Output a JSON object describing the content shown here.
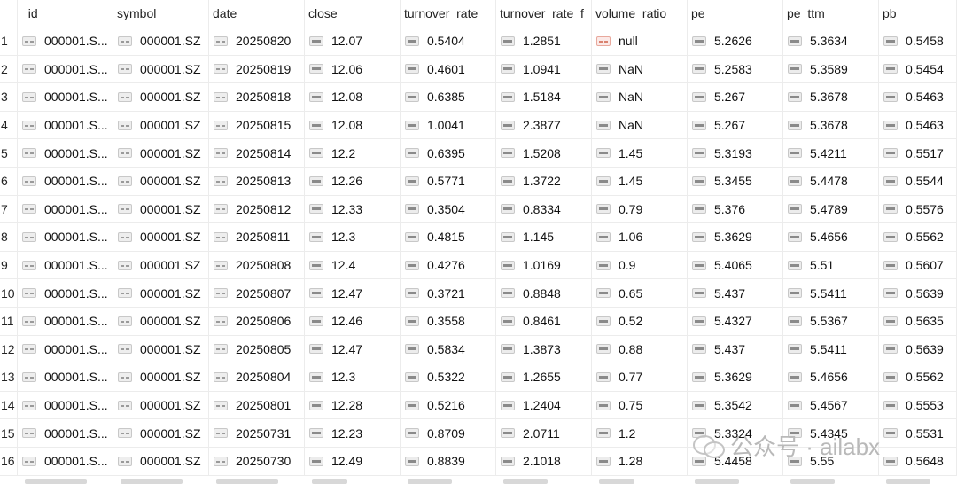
{
  "columns": [
    "_id",
    "symbol",
    "date",
    "close",
    "turnover_rate",
    "turnover_rate_f",
    "volume_ratio",
    "pe",
    "pe_ttm",
    "pb"
  ],
  "rows": [
    {
      "n": "1",
      "id": "000001.S...",
      "symbol": "000001.SZ",
      "date": "20250820",
      "close": "12.07",
      "tr": "0.5404",
      "trf": "1.2851",
      "vr": "null",
      "pe": "5.2626",
      "pettm": "5.3634",
      "pb": "0.5458"
    },
    {
      "n": "2",
      "id": "000001.S...",
      "symbol": "000001.SZ",
      "date": "20250819",
      "close": "12.06",
      "tr": "0.4601",
      "trf": "1.0941",
      "vr": "NaN",
      "pe": "5.2583",
      "pettm": "5.3589",
      "pb": "0.5454"
    },
    {
      "n": "3",
      "id": "000001.S...",
      "symbol": "000001.SZ",
      "date": "20250818",
      "close": "12.08",
      "tr": "0.6385",
      "trf": "1.5184",
      "vr": "NaN",
      "pe": "5.267",
      "pettm": "5.3678",
      "pb": "0.5463"
    },
    {
      "n": "4",
      "id": "000001.S...",
      "symbol": "000001.SZ",
      "date": "20250815",
      "close": "12.08",
      "tr": "1.0041",
      "trf": "2.3877",
      "vr": "NaN",
      "pe": "5.267",
      "pettm": "5.3678",
      "pb": "0.5463"
    },
    {
      "n": "5",
      "id": "000001.S...",
      "symbol": "000001.SZ",
      "date": "20250814",
      "close": "12.2",
      "tr": "0.6395",
      "trf": "1.5208",
      "vr": "1.45",
      "pe": "5.3193",
      "pettm": "5.4211",
      "pb": "0.5517"
    },
    {
      "n": "6",
      "id": "000001.S...",
      "symbol": "000001.SZ",
      "date": "20250813",
      "close": "12.26",
      "tr": "0.5771",
      "trf": "1.3722",
      "vr": "1.45",
      "pe": "5.3455",
      "pettm": "5.4478",
      "pb": "0.5544"
    },
    {
      "n": "7",
      "id": "000001.S...",
      "symbol": "000001.SZ",
      "date": "20250812",
      "close": "12.33",
      "tr": "0.3504",
      "trf": "0.8334",
      "vr": "0.79",
      "pe": "5.376",
      "pettm": "5.4789",
      "pb": "0.5576"
    },
    {
      "n": "8",
      "id": "000001.S...",
      "symbol": "000001.SZ",
      "date": "20250811",
      "close": "12.3",
      "tr": "0.4815",
      "trf": "1.145",
      "vr": "1.06",
      "pe": "5.3629",
      "pettm": "5.4656",
      "pb": "0.5562"
    },
    {
      "n": "9",
      "id": "000001.S...",
      "symbol": "000001.SZ",
      "date": "20250808",
      "close": "12.4",
      "tr": "0.4276",
      "trf": "1.0169",
      "vr": "0.9",
      "pe": "5.4065",
      "pettm": "5.51",
      "pb": "0.5607"
    },
    {
      "n": "10",
      "id": "000001.S...",
      "symbol": "000001.SZ",
      "date": "20250807",
      "close": "12.47",
      "tr": "0.3721",
      "trf": "0.8848",
      "vr": "0.65",
      "pe": "5.437",
      "pettm": "5.5411",
      "pb": "0.5639"
    },
    {
      "n": "11",
      "id": "000001.S...",
      "symbol": "000001.SZ",
      "date": "20250806",
      "close": "12.46",
      "tr": "0.3558",
      "trf": "0.8461",
      "vr": "0.52",
      "pe": "5.4327",
      "pettm": "5.5367",
      "pb": "0.5635"
    },
    {
      "n": "12",
      "id": "000001.S...",
      "symbol": "000001.SZ",
      "date": "20250805",
      "close": "12.47",
      "tr": "0.5834",
      "trf": "1.3873",
      "vr": "0.88",
      "pe": "5.437",
      "pettm": "5.5411",
      "pb": "0.5639"
    },
    {
      "n": "13",
      "id": "000001.S...",
      "symbol": "000001.SZ",
      "date": "20250804",
      "close": "12.3",
      "tr": "0.5322",
      "trf": "1.2655",
      "vr": "0.77",
      "pe": "5.3629",
      "pettm": "5.4656",
      "pb": "0.5562"
    },
    {
      "n": "14",
      "id": "000001.S...",
      "symbol": "000001.SZ",
      "date": "20250801",
      "close": "12.28",
      "tr": "0.5216",
      "trf": "1.2404",
      "vr": "0.75",
      "pe": "5.3542",
      "pettm": "5.4567",
      "pb": "0.5553"
    },
    {
      "n": "15",
      "id": "000001.S...",
      "symbol": "000001.SZ",
      "date": "20250731",
      "close": "12.23",
      "tr": "0.8709",
      "trf": "2.0711",
      "vr": "1.2",
      "pe": "5.3324",
      "pettm": "5.4345",
      "pb": "0.5531"
    },
    {
      "n": "16",
      "id": "000001.S...",
      "symbol": "000001.SZ",
      "date": "20250730",
      "close": "12.49",
      "tr": "0.8839",
      "trf": "2.1018",
      "vr": "1.28",
      "pe": "5.4458",
      "pettm": "5.55",
      "pb": "0.5648"
    }
  ],
  "watermark": "公众号 · ailabx",
  "colors": {
    "grid_line": "#ececec",
    "null_icon": "#fbe9e7",
    "watermark": "#b9b9b9"
  }
}
